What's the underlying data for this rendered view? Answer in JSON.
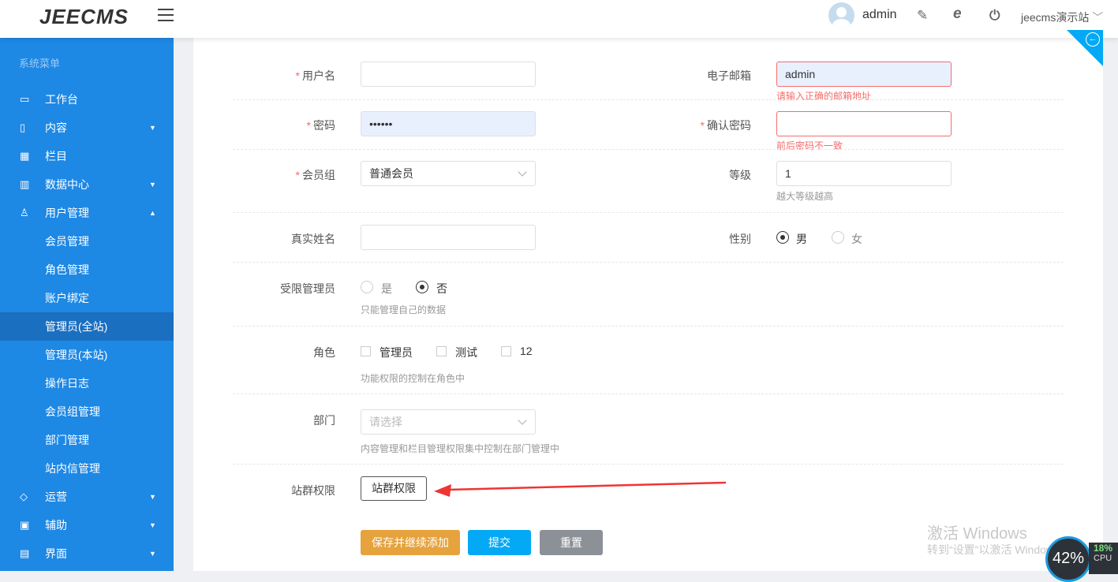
{
  "header": {
    "logo": "JEECMS",
    "user": "admin",
    "site": "jeecms演示站"
  },
  "sidebar": {
    "title": "系统菜单",
    "items": [
      {
        "label": "工作台",
        "icon": "monitor-icon"
      },
      {
        "label": "内容",
        "icon": "file-icon"
      },
      {
        "label": "栏目",
        "icon": "grid-icon"
      },
      {
        "label": "数据中心",
        "icon": "chart-icon"
      },
      {
        "label": "用户管理",
        "icon": "user-icon"
      },
      {
        "label": "会员管理"
      },
      {
        "label": "角色管理"
      },
      {
        "label": "账户绑定"
      },
      {
        "label": "管理员(全站)"
      },
      {
        "label": "管理员(本站)"
      },
      {
        "label": "操作日志"
      },
      {
        "label": "会员组管理"
      },
      {
        "label": "部门管理"
      },
      {
        "label": "站内信管理"
      },
      {
        "label": "运营",
        "icon": "shield-icon"
      },
      {
        "label": "辅助",
        "icon": "box-icon"
      },
      {
        "label": "界面",
        "icon": "layout-icon"
      }
    ]
  },
  "form": {
    "username_label": "用户名",
    "username_value": "",
    "email_label": "电子邮箱",
    "email_value": "admin",
    "email_error": "请输入正确的邮箱地址",
    "password_label": "密码",
    "password_value": "••••••",
    "confirm_label": "确认密码",
    "confirm_value": "",
    "confirm_error": "前后密码不一致",
    "group_label": "会员组",
    "group_value": "普通会员",
    "level_label": "等级",
    "level_value": "1",
    "level_hint": "越大等级越高",
    "realname_label": "真实姓名",
    "realname_value": "",
    "gender_label": "性别",
    "gender_male": "男",
    "gender_female": "女",
    "gender_selected": "男",
    "restricted_label": "受限管理员",
    "restricted_yes": "是",
    "restricted_no": "否",
    "restricted_selected": "否",
    "restricted_hint": "只能管理自己的数据",
    "role_label": "角色",
    "roles": [
      "管理员",
      "测试",
      "12"
    ],
    "role_hint": "功能权限的控制在角色中",
    "dept_label": "部门",
    "dept_placeholder": "请选择",
    "dept_hint": "内容管理和栏目管理权限集中控制在部门管理中",
    "sitegroup_label": "站群权限",
    "sitegroup_button": "站群权限",
    "save_continue": "保存并继续添加",
    "submit": "提交",
    "reset": "重置"
  },
  "overlay": {
    "wm1": "激活 Windows",
    "wm2": "转到“设置”以激活 Windows。",
    "gauge": "42%",
    "cpu": "18%",
    "cpu_label": "CPU"
  }
}
